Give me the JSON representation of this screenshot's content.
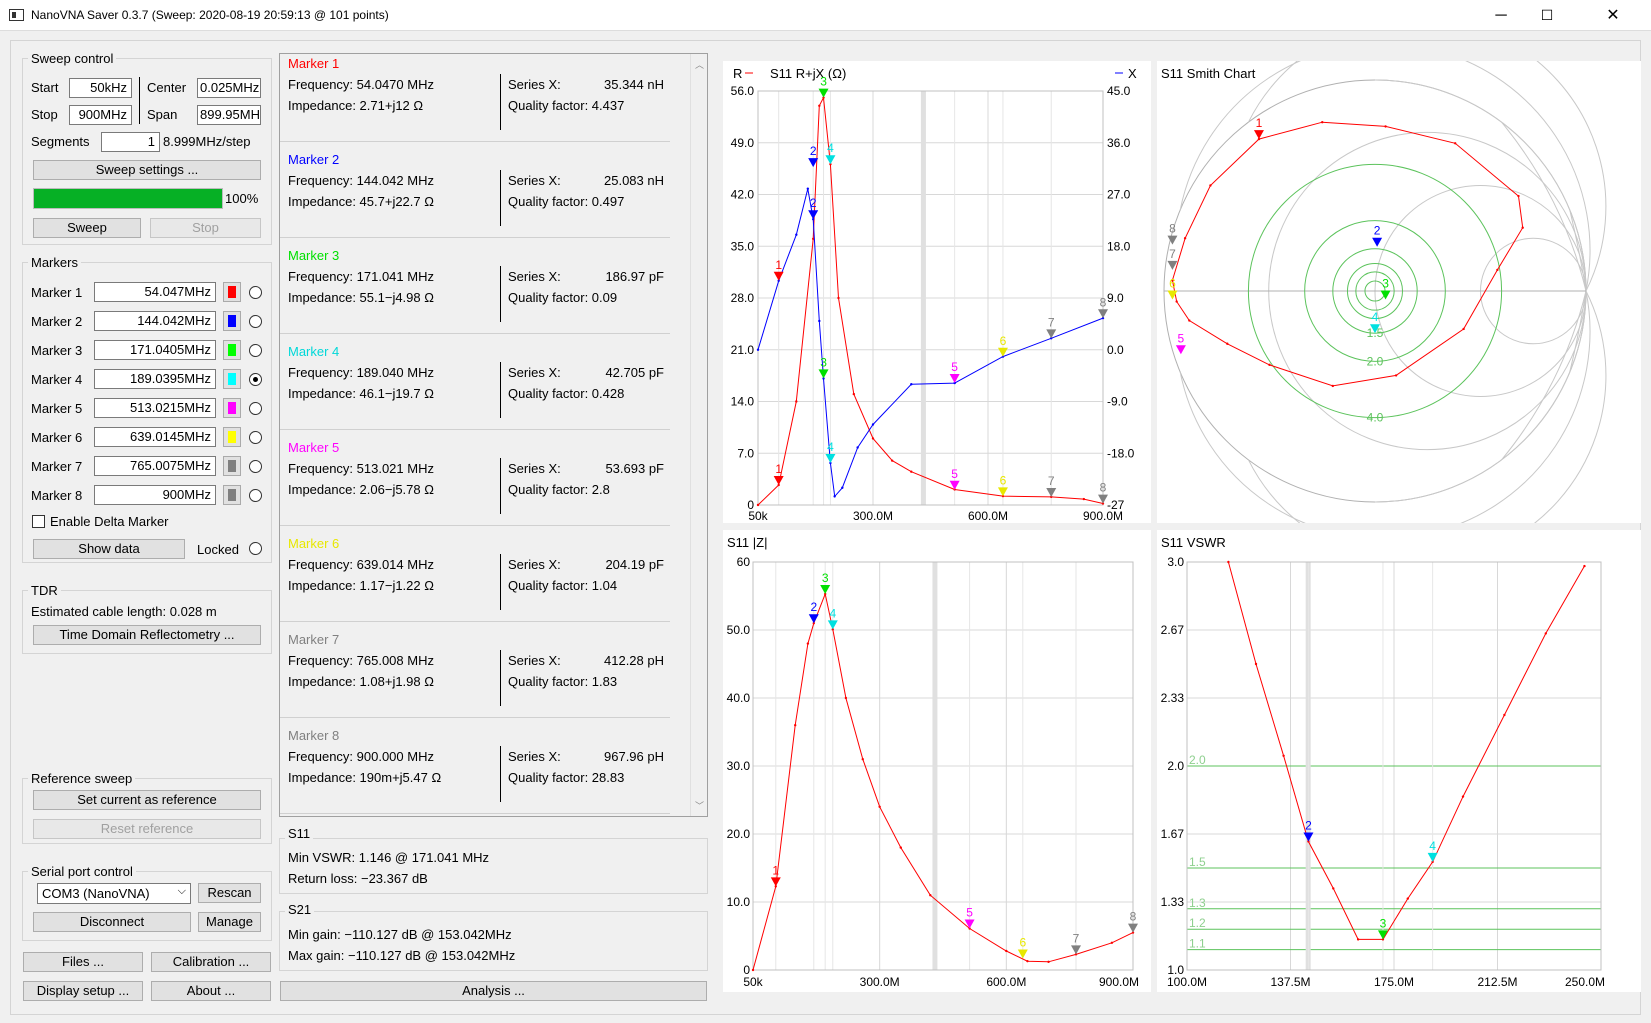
{
  "window": {
    "title": "NanoVNA Saver 0.3.7 (Sweep: 2020-08-19 20:59:13 @ 101 points)",
    "minimize": "─",
    "maximize": "☐",
    "close": "✕"
  },
  "sweep_control": {
    "title": "Sweep control",
    "start_label": "Start",
    "start_value": "50kHz",
    "center_label": "Center",
    "center_value": "0.025MHz",
    "stop_label": "Stop",
    "stop_value": "900MHz",
    "span_label": "Span",
    "span_value": "899.95MHz",
    "segments_label": "Segments",
    "segments_value": "1",
    "step_text": "8.999MHz/step",
    "settings_button": "Sweep settings ...",
    "progress": 1.0,
    "progress_text": "100%",
    "sweep_button": "Sweep",
    "stop_button": "Stop"
  },
  "markers_panel": {
    "title": "Markers",
    "items": [
      {
        "label": "Marker 1",
        "value": "54.047MHz",
        "color": "#ff0000",
        "selected": false
      },
      {
        "label": "Marker 2",
        "value": "144.042MHz",
        "color": "#0000ff",
        "selected": false
      },
      {
        "label": "Marker 3",
        "value": "171.0405MHz",
        "color": "#00ff00",
        "selected": false
      },
      {
        "label": "Marker 4",
        "value": "189.0395MHz",
        "color": "#00ffff",
        "selected": true
      },
      {
        "label": "Marker 5",
        "value": "513.0215MHz",
        "color": "#ff00ff",
        "selected": false
      },
      {
        "label": "Marker 6",
        "value": "639.0145MHz",
        "color": "#ffff00",
        "selected": false
      },
      {
        "label": "Marker 7",
        "value": "765.0075MHz",
        "color": "#808080",
        "selected": false
      },
      {
        "label": "Marker 8",
        "value": "900MHz",
        "color": "#808080",
        "selected": false
      }
    ],
    "delta_label": "Enable Delta Marker",
    "show_data_button": "Show data",
    "locked_label": "Locked"
  },
  "tdr": {
    "title": "TDR",
    "cable_length": "Estimated cable length: 0.028 m",
    "button": "Time Domain Reflectometry ..."
  },
  "reference_sweep": {
    "title": "Reference sweep",
    "set_button": "Set current as reference",
    "reset_button": "Reset reference"
  },
  "serial_port": {
    "title": "Serial port control",
    "port_value": "COM3 (NanoVNA)",
    "rescan_button": "Rescan",
    "disconnect_button": "Disconnect",
    "manage_button": "Manage"
  },
  "bottom_buttons": {
    "files": "Files ...",
    "calibration": "Calibration ...",
    "display_setup": "Display setup ...",
    "about": "About ...",
    "analysis": "Analysis ..."
  },
  "marker_details": [
    {
      "title": "Marker 1",
      "color": "#ff0000",
      "frequency": "Frequency: 54.0470 MHz",
      "impedance": "Impedance: 2.71+j12 Ω",
      "series_label": "Series X:",
      "series_value": "35.344 nH",
      "q": "Quality factor: 4.437"
    },
    {
      "title": "Marker 2",
      "color": "#0000ff",
      "frequency": "Frequency: 144.042 MHz",
      "impedance": "Impedance: 45.7+j22.7 Ω",
      "series_label": "Series X:",
      "series_value": "25.083 nH",
      "q": "Quality factor: 0.497"
    },
    {
      "title": "Marker 3",
      "color": "#00e000",
      "frequency": "Frequency: 171.041 MHz",
      "impedance": "Impedance: 55.1−j4.98 Ω",
      "series_label": "Series X:",
      "series_value": "186.97 pF",
      "q": "Quality factor: 0.09"
    },
    {
      "title": "Marker 4",
      "color": "#00d8d8",
      "frequency": "Frequency: 189.040 MHz",
      "impedance": "Impedance: 46.1−j19.7 Ω",
      "series_label": "Series X:",
      "series_value": "42.705 pF",
      "q": "Quality factor: 0.428"
    },
    {
      "title": "Marker 5",
      "color": "#ff00ff",
      "frequency": "Frequency: 513.021 MHz",
      "impedance": "Impedance: 2.06−j5.78 Ω",
      "series_label": "Series X:",
      "series_value": "53.693 pF",
      "q": "Quality factor: 2.8"
    },
    {
      "title": "Marker 6",
      "color": "#e8e800",
      "frequency": "Frequency: 639.014 MHz",
      "impedance": "Impedance: 1.17−j1.22 Ω",
      "series_label": "Series X:",
      "series_value": "204.19 pF",
      "q": "Quality factor: 1.04"
    },
    {
      "title": "Marker 7",
      "color": "#808080",
      "frequency": "Frequency: 765.008 MHz",
      "impedance": "Impedance: 1.08+j1.98 Ω",
      "series_label": "Series X:",
      "series_value": "412.28 pH",
      "q": "Quality factor: 1.83"
    },
    {
      "title": "Marker 8",
      "color": "#808080",
      "frequency": "Frequency: 900.000 MHz",
      "impedance": "Impedance: 190m+j5.47 Ω",
      "series_label": "Series X:",
      "series_value": "967.96 pH",
      "q": "Quality factor: 28.83"
    }
  ],
  "s11_summary": {
    "title": "S11",
    "min_vswr": "Min VSWR:  1.146 @ 171.041 MHz",
    "return_loss": "Return loss: −23.367 dB"
  },
  "s21_summary": {
    "title": "S21",
    "min_gain": "Min gain:  −110.127 dB @ 153.042MHz",
    "max_gain": "Max gain:  −110.127 dB @ 153.042MHz"
  },
  "chart_data": [
    {
      "type": "line",
      "title": "S11  R+jX (Ω)",
      "left_legend": "R",
      "right_legend": "X",
      "left_ticks": [
        "56.0",
        "49.0",
        "42.0",
        "35.0",
        "28.0",
        "21.0",
        "14.0",
        "7.0",
        "0"
      ],
      "right_ticks": [
        "45.0",
        "36.0",
        "27.0",
        "18.0",
        "9.0",
        "0.0",
        "-9.0",
        "-18.0",
        "-27"
      ],
      "x_ticks": [
        "50k",
        "300.0M",
        "600.0M",
        "900.0M"
      ],
      "ylim_left": [
        0,
        56
      ],
      "ylim_right": [
        -27,
        45
      ],
      "xlim": [
        0.05,
        900
      ],
      "series": [
        {
          "legend": "R",
          "color": "#ff0000",
          "x": [
            0.05,
            54,
            100,
            144,
            160,
            171,
            189,
            210,
            250,
            300,
            350,
            400,
            513,
            639,
            765,
            850,
            900
          ],
          "y": [
            0,
            2.7,
            14,
            36,
            54,
            55.1,
            46.1,
            28,
            15,
            9,
            6,
            4.5,
            2.1,
            1.2,
            1.1,
            0.8,
            0.2
          ]
        },
        {
          "legend": "X",
          "color": "#0000ff",
          "x": [
            0.05,
            54,
            100,
            130,
            144,
            160,
            171,
            189,
            200,
            220,
            260,
            300,
            400,
            513,
            639,
            765,
            900
          ],
          "y": [
            0,
            12,
            20,
            28,
            22.7,
            5,
            -5,
            -19.7,
            -25.5,
            -24,
            -17,
            -13,
            -6,
            -5.8,
            -1.2,
            2,
            5.5
          ]
        }
      ],
      "markers": [
        {
          "label": "1",
          "color": "#ff0000",
          "x": 54,
          "r": 2.71,
          "x_val": 12
        },
        {
          "label": "2",
          "color": "#0000ff",
          "x": 144,
          "r": 45.7,
          "x_val": 22.7
        },
        {
          "label": "3",
          "color": "#00e000",
          "x": 171,
          "r": 55.1,
          "x_val": -4.98
        },
        {
          "label": "4",
          "color": "#00e0e0",
          "x": 189,
          "r": 46.1,
          "x_val": -19.7
        },
        {
          "label": "5",
          "color": "#ff00ff",
          "x": 513,
          "r": 2.06,
          "x_val": -5.78
        },
        {
          "label": "6",
          "color": "#e8e800",
          "x": 639,
          "r": 1.17,
          "x_val": -1.22
        },
        {
          "label": "7",
          "color": "#808080",
          "x": 765,
          "r": 1.08,
          "x_val": 1.98
        },
        {
          "label": "8",
          "color": "#808080",
          "x": 900,
          "r": 0.19,
          "x_val": 5.47
        }
      ]
    },
    {
      "type": "scatter",
      "title": "S11 Smith Chart",
      "circle_labels": [
        "1.5",
        "2.0",
        "4.0"
      ],
      "series": [
        {
          "color": "#ff0000",
          "gamma": [
            [
              -0.96,
              0.05
            ],
            [
              -0.9,
              0.25
            ],
            [
              -0.78,
              0.5
            ],
            [
              -0.55,
              0.72
            ],
            [
              -0.25,
              0.8
            ],
            [
              0.05,
              0.78
            ],
            [
              0.38,
              0.7
            ],
            [
              0.68,
              0.45
            ],
            [
              0.7,
              0.3
            ],
            [
              0.58,
              0.1
            ],
            [
              0.42,
              -0.18
            ],
            [
              0.1,
              -0.4
            ],
            [
              -0.2,
              -0.45
            ],
            [
              -0.5,
              -0.35
            ],
            [
              -0.7,
              -0.25
            ],
            [
              -0.88,
              -0.14
            ],
            [
              -0.94,
              -0.05
            ],
            [
              -0.96,
              0.05
            ]
          ]
        }
      ],
      "markers": [
        {
          "label": "1",
          "color": "#ff0000",
          "re": -0.55,
          "im": 0.72
        },
        {
          "label": "2",
          "color": "#0000ff",
          "re": 0.01,
          "im": 0.21
        },
        {
          "label": "3",
          "color": "#00e000",
          "re": 0.05,
          "im": -0.04
        },
        {
          "label": "4",
          "color": "#00e0e0",
          "re": 0.0,
          "im": -0.2
        },
        {
          "label": "5",
          "color": "#ff00ff",
          "re": -0.92,
          "im": -0.3
        },
        {
          "label": "6",
          "color": "#e8e800",
          "re": -0.96,
          "im": -0.04
        },
        {
          "label": "7",
          "color": "#808080",
          "re": -0.96,
          "im": 0.1
        },
        {
          "label": "8",
          "color": "#808080",
          "re": -0.96,
          "im": 0.22
        }
      ]
    },
    {
      "type": "line",
      "title": "S11  |Z|",
      "y_ticks": [
        "60",
        "50.0",
        "40.0",
        "30.0",
        "20.0",
        "10.0",
        "0"
      ],
      "x_ticks": [
        "50k",
        "300.0M",
        "600.0M",
        "900.0M"
      ],
      "ylim": [
        0,
        60
      ],
      "xlim": [
        0.05,
        900
      ],
      "series": [
        {
          "color": "#ff0000",
          "x": [
            0.05,
            54,
            100,
            130,
            144,
            171,
            189,
            220,
            260,
            300,
            350,
            420,
            513,
            600,
            650,
            700,
            765,
            850,
            900
          ],
          "y": [
            0,
            12.3,
            36,
            48,
            51,
            55.3,
            50.1,
            40,
            31,
            24,
            18,
            11,
            6.1,
            2.8,
            1.3,
            1.2,
            2.3,
            4,
            5.5
          ]
        }
      ],
      "markers": [
        {
          "label": "1",
          "color": "#ff0000",
          "x": 54,
          "y": 12.3
        },
        {
          "label": "2",
          "color": "#0000ff",
          "x": 144,
          "y": 51
        },
        {
          "label": "3",
          "color": "#00e000",
          "x": 171,
          "y": 55.3
        },
        {
          "label": "4",
          "color": "#00e0e0",
          "x": 189,
          "y": 50.1
        },
        {
          "label": "5",
          "color": "#ff00ff",
          "x": 513,
          "y": 6.1
        },
        {
          "label": "6",
          "color": "#e8e800",
          "x": 639,
          "y": 1.7
        },
        {
          "label": "7",
          "color": "#808080",
          "x": 765,
          "y": 2.3
        },
        {
          "label": "8",
          "color": "#808080",
          "x": 900,
          "y": 5.5
        }
      ]
    },
    {
      "type": "line",
      "title": "S11  VSWR",
      "y_ticks": [
        "3.0",
        "2.67",
        "2.33",
        "2.0",
        "1.67",
        "1.33",
        "1.0"
      ],
      "x_ticks": [
        "100.0M",
        "137.5M",
        "175.0M",
        "212.5M",
        "250.0M"
      ],
      "ylim": [
        1.0,
        3.0
      ],
      "xlim": [
        100,
        250
      ],
      "ref_lines": [
        {
          "value": 2.0,
          "label": "2.0"
        },
        {
          "value": 1.5,
          "label": "1.5"
        },
        {
          "value": 1.3,
          "label": "1.3"
        },
        {
          "value": 1.2,
          "label": "1.2"
        },
        {
          "value": 1.1,
          "label": "1.1"
        }
      ],
      "series": [
        {
          "color": "#ff0000",
          "x": [
            115,
            125,
            135,
            144,
            153,
            162,
            171,
            180,
            189,
            200,
            215,
            230,
            244
          ],
          "y": [
            3.0,
            2.5,
            2.05,
            1.63,
            1.4,
            1.15,
            1.15,
            1.35,
            1.53,
            1.85,
            2.25,
            2.65,
            2.98
          ]
        }
      ],
      "markers": [
        {
          "label": "2",
          "color": "#0000ff",
          "x": 144,
          "y": 1.63
        },
        {
          "label": "3",
          "color": "#00e000",
          "x": 171,
          "y": 1.15
        },
        {
          "label": "4",
          "color": "#00e0e0",
          "x": 189,
          "y": 1.53
        }
      ]
    }
  ]
}
